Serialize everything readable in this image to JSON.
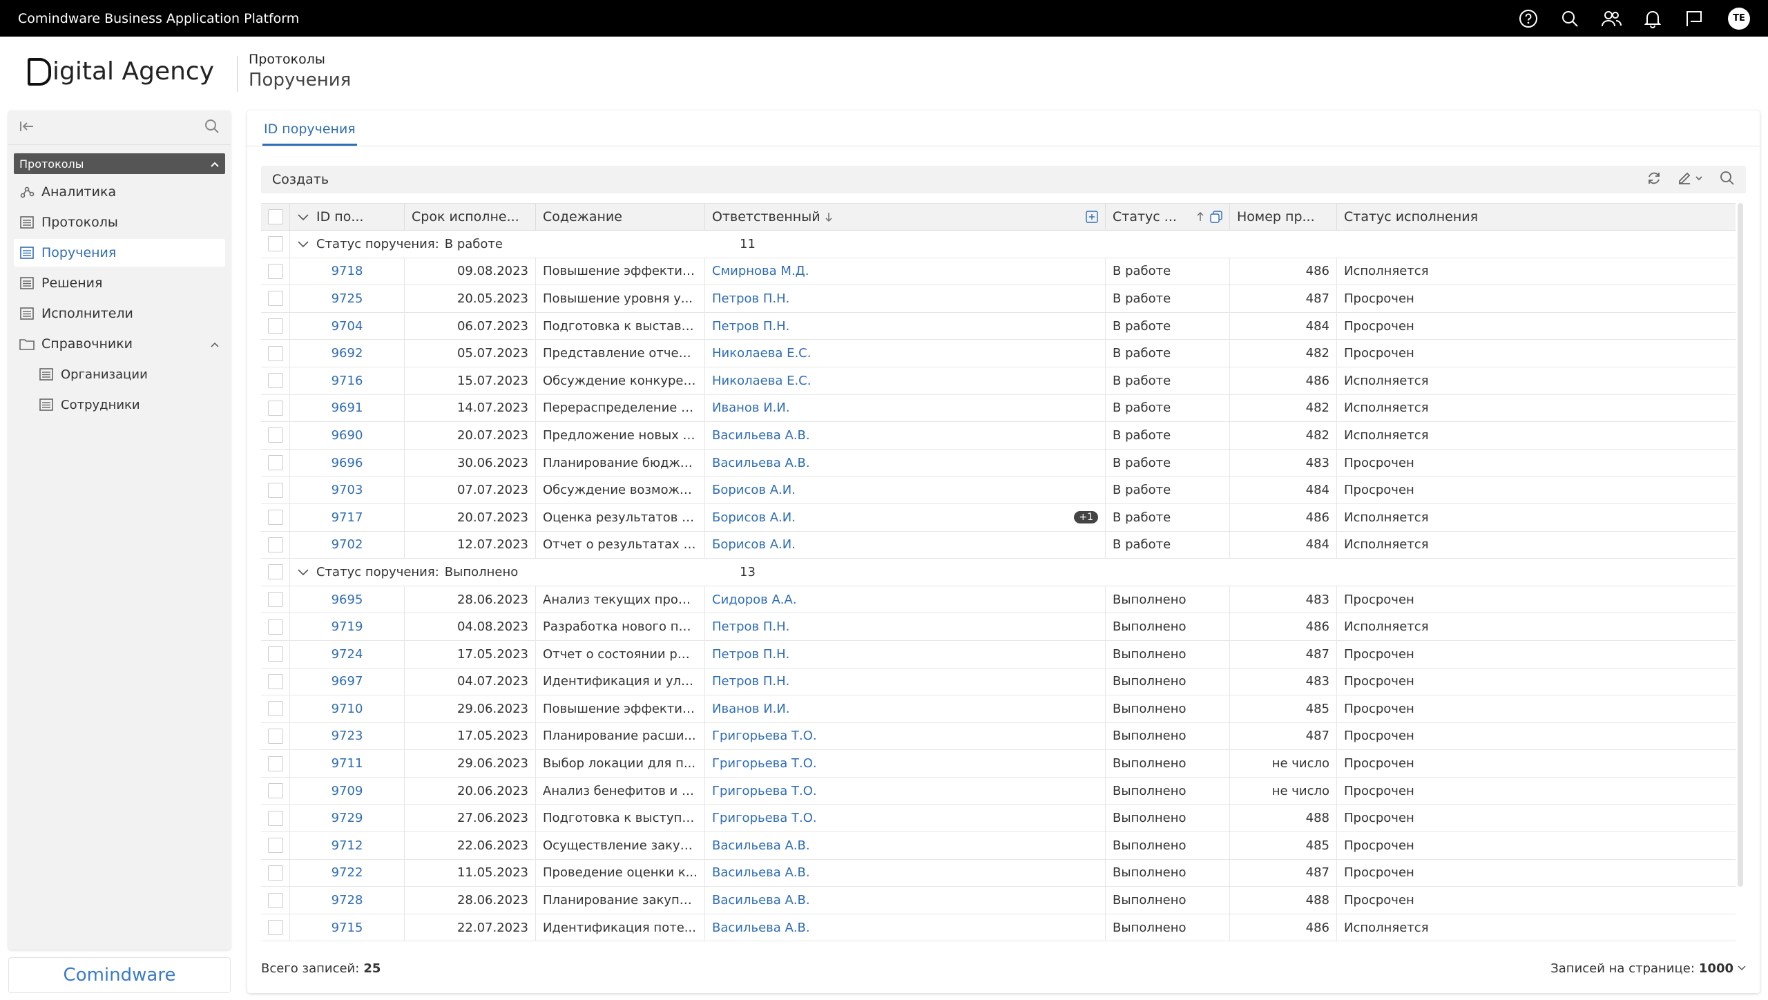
{
  "app": {
    "title": "Comindware Business Application Platform",
    "avatar_initials": "TE"
  },
  "brand": {
    "logo_text": "igital Agency",
    "breadcrumb_parent": "Протоколы",
    "breadcrumb_current": "Поручения"
  },
  "sidebar": {
    "group_label": "Протоколы",
    "items": [
      {
        "label": "Аналитика",
        "icon": "analytics-icon"
      },
      {
        "label": "Протоколы",
        "icon": "list-icon"
      },
      {
        "label": "Поручения",
        "icon": "list-icon",
        "active": true
      },
      {
        "label": "Решения",
        "icon": "list-icon"
      },
      {
        "label": "Исполнители",
        "icon": "list-icon"
      },
      {
        "label": "Справочники",
        "icon": "folder-icon"
      }
    ],
    "sub_items": [
      {
        "label": "Организации",
        "icon": "list-icon"
      },
      {
        "label": "Сотрудники",
        "icon": "list-icon"
      }
    ],
    "footer_logo": "Comindware"
  },
  "main": {
    "tab_label": "ID поручения",
    "toolbar": {
      "create_label": "Создать"
    },
    "columns": {
      "id": "ID по...",
      "date": "Срок исполне...",
      "content": "Содежание",
      "responsible": "Ответственный",
      "status": "Статус ...",
      "number": "Номер пр...",
      "exec_status": "Статус исполнения"
    },
    "groups": [
      {
        "label": "Статус поручения:",
        "value": "В работе",
        "count": "11",
        "rows": [
          {
            "id": "9718",
            "date": "09.08.2023",
            "content": "Повышение эффектив...",
            "responsible": "Смирнова М.Д.",
            "status": "В работе",
            "number": "486",
            "exec": "Исполняется"
          },
          {
            "id": "9725",
            "date": "20.05.2023",
            "content": "Повышение уровня у...",
            "responsible": "Петров П.Н.",
            "status": "В работе",
            "number": "487",
            "exec": "Просрочен"
          },
          {
            "id": "9704",
            "date": "06.07.2023",
            "content": "Подготовка к выставк...",
            "responsible": "Петров П.Н.",
            "status": "В работе",
            "number": "484",
            "exec": "Просрочен"
          },
          {
            "id": "9692",
            "date": "05.07.2023",
            "content": "Представление отчет...",
            "responsible": "Николаева Е.С.",
            "status": "В работе",
            "number": "482",
            "exec": "Просрочен"
          },
          {
            "id": "9716",
            "date": "15.07.2023",
            "content": "Обсуждение конкурен...",
            "responsible": "Николаева Е.С.",
            "status": "В работе",
            "number": "486",
            "exec": "Исполняется"
          },
          {
            "id": "9691",
            "date": "14.07.2023",
            "content": "Перераспределение р...",
            "responsible": "Иванов И.И.",
            "status": "В работе",
            "number": "482",
            "exec": "Исполняется"
          },
          {
            "id": "9690",
            "date": "20.07.2023",
            "content": "Предложение новых с...",
            "responsible": "Васильева А.В.",
            "status": "В работе",
            "number": "482",
            "exec": "Исполняется"
          },
          {
            "id": "9696",
            "date": "30.06.2023",
            "content": "Планирование бюдже...",
            "responsible": "Васильева А.В.",
            "status": "В работе",
            "number": "483",
            "exec": "Просрочен"
          },
          {
            "id": "9703",
            "date": "07.07.2023",
            "content": "Обсуждение возможн...",
            "responsible": "Борисов А.И.",
            "status": "В работе",
            "number": "484",
            "exec": "Просрочен"
          },
          {
            "id": "9717",
            "date": "20.07.2023",
            "content": "Оценка результатов п...",
            "responsible": "Борисов А.И.",
            "badge": "+1",
            "status": "В работе",
            "number": "486",
            "exec": "Исполняется"
          },
          {
            "id": "9702",
            "date": "12.07.2023",
            "content": "Отчет о результатах п...",
            "responsible": "Борисов А.И.",
            "status": "В работе",
            "number": "484",
            "exec": "Исполняется"
          }
        ]
      },
      {
        "label": "Статус поручения:",
        "value": "Выполнено",
        "count": "13",
        "rows": [
          {
            "id": "9695",
            "date": "28.06.2023",
            "content": "Анализ текущих прод...",
            "responsible": "Сидоров А.А.",
            "status": "Выполнено",
            "number": "483",
            "exec": "Просрочен"
          },
          {
            "id": "9719",
            "date": "04.08.2023",
            "content": "Разработка нового пр...",
            "responsible": "Петров П.Н.",
            "status": "Выполнено",
            "number": "486",
            "exec": "Исполняется"
          },
          {
            "id": "9724",
            "date": "17.05.2023",
            "content": "Отчет о состоянии ры...",
            "responsible": "Петров П.Н.",
            "status": "Выполнено",
            "number": "487",
            "exec": "Просрочен"
          },
          {
            "id": "9697",
            "date": "04.07.2023",
            "content": "Идентификация и улу...",
            "responsible": "Петров П.Н.",
            "status": "Выполнено",
            "number": "483",
            "exec": "Просрочен"
          },
          {
            "id": "9710",
            "date": "29.06.2023",
            "content": "Повышение эффектив...",
            "responsible": "Иванов И.И.",
            "status": "Выполнено",
            "number": "485",
            "exec": "Просрочен"
          },
          {
            "id": "9723",
            "date": "17.05.2023",
            "content": "Планирование расши...",
            "responsible": "Григорьева Т.О.",
            "status": "Выполнено",
            "number": "487",
            "exec": "Просрочен"
          },
          {
            "id": "9711",
            "date": "29.06.2023",
            "content": "Выбор локации для п...",
            "responsible": "Григорьева Т.О.",
            "status": "Выполнено",
            "number": "не число",
            "exec": "Просрочен"
          },
          {
            "id": "9709",
            "date": "20.06.2023",
            "content": "Анализ бенефитов и п...",
            "responsible": "Григорьева Т.О.",
            "status": "Выполнено",
            "number": "не число",
            "exec": "Просрочен"
          },
          {
            "id": "9729",
            "date": "27.06.2023",
            "content": "Подготовка к выступл...",
            "responsible": "Григорьева Т.О.",
            "status": "Выполнено",
            "number": "488",
            "exec": "Просрочен"
          },
          {
            "id": "9712",
            "date": "22.06.2023",
            "content": "Осуществление закуп...",
            "responsible": "Васильева А.В.",
            "status": "Выполнено",
            "number": "485",
            "exec": "Просрочен"
          },
          {
            "id": "9722",
            "date": "11.05.2023",
            "content": "Проведение оценки к...",
            "responsible": "Васильева А.В.",
            "status": "Выполнено",
            "number": "487",
            "exec": "Просрочен"
          },
          {
            "id": "9728",
            "date": "28.06.2023",
            "content": "Планирование закупо...",
            "responsible": "Васильева А.В.",
            "status": "Выполнено",
            "number": "488",
            "exec": "Просрочен"
          },
          {
            "id": "9715",
            "date": "22.07.2023",
            "content": "Идентификация поте...",
            "responsible": "Васильева А.В.",
            "status": "Выполнено",
            "number": "486",
            "exec": "Исполняется"
          }
        ]
      }
    ],
    "footer": {
      "total_label": "Всего записей:",
      "total_value": "25",
      "per_page_label": "Записей на странице:",
      "per_page_value": "1000"
    }
  },
  "colors": {
    "accent": "#2f6db5",
    "topbar": "#000000",
    "group_header": "#555555"
  }
}
